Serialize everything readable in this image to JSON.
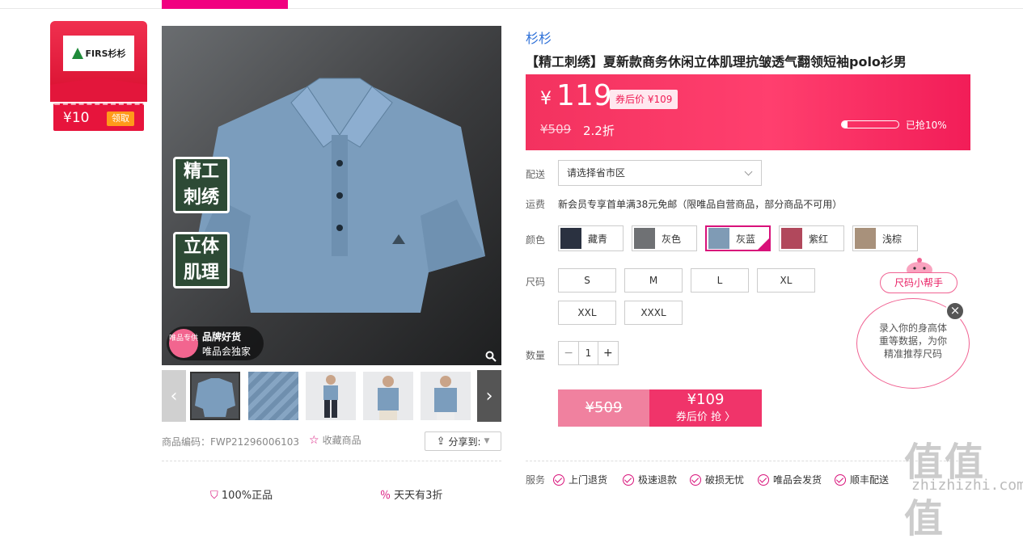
{
  "brand_card": {
    "logo": "FIRS杉杉",
    "coupon_amount": "¥10",
    "coupon_button": "领取"
  },
  "main_image": {
    "tag1": [
      "精工",
      "刺绣"
    ],
    "tag2": [
      "立体",
      "肌理"
    ],
    "badge_circle": "唯品专供",
    "badge_line1": "品牌好货",
    "badge_line2": "唯品会独家"
  },
  "product_code": "商品编码：FWP21296006103",
  "favorite": "收藏商品",
  "share": "分享到:",
  "bottom": {
    "item1": "100%正品",
    "item2": "天天有3折"
  },
  "brand": "杉杉",
  "title": "【精工刺绣】夏新款商务休闲立体肌理抗皱透气翻领短袖polo衫男",
  "price": {
    "yen": "¥",
    "current": "119",
    "after_coupon": "券后价 ¥109",
    "original": "¥509",
    "discount": "2.2折",
    "sold_fraction": 0.1,
    "sold_label": "已抢10%"
  },
  "labels": {
    "delivery": "配送",
    "shipping": "运费",
    "color": "颜色",
    "size": "尺码",
    "quantity": "数量",
    "service": "服务"
  },
  "delivery_placeholder": "请选择省市区",
  "shipping_text": "新会员专享首单满38元免邮（限唯品自营商品，部分商品不可用）",
  "colors": [
    {
      "name": "藏青",
      "hex": "#2a3140"
    },
    {
      "name": "灰色",
      "hex": "#6f7174"
    },
    {
      "name": "灰蓝",
      "hex": "#7f9bb5",
      "selected": true
    },
    {
      "name": "紫红",
      "hex": "#b1485c"
    },
    {
      "name": "浅棕",
      "hex": "#a8917b"
    }
  ],
  "sizes": [
    "S",
    "M",
    "L",
    "XL",
    "XXL",
    "XXXL"
  ],
  "quantity": {
    "minus": "−",
    "value": "1",
    "plus": "+"
  },
  "buy": {
    "orig": "¥509",
    "price": "¥109",
    "label": "券后价 抢 〉"
  },
  "services": [
    "上门退货",
    "极速退款",
    "破损无忧",
    "唯品会发货",
    "顺丰配送"
  ],
  "size_helper": {
    "pill": "尺码小帮手",
    "line1": "录入你的身高体",
    "line2": "重等数据，为你",
    "line3": "精准推荐尺码",
    "close": "×"
  },
  "watermark": {
    "main": "值值值",
    "url": "zhizhizhi.com"
  },
  "colors_theme": {
    "accent": "#f10180",
    "price_bg": "#f3325f",
    "brand_blue": "#2c6fd8"
  }
}
